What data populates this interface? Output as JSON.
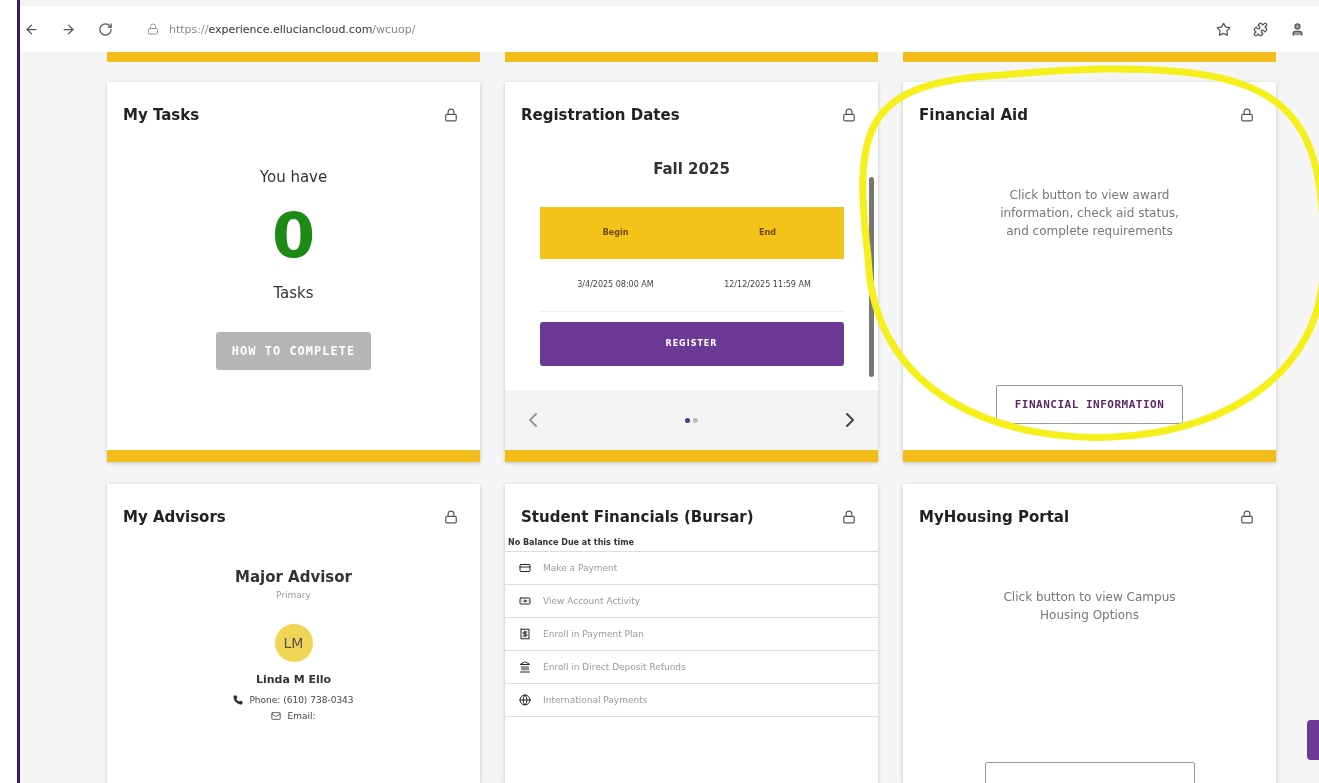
{
  "browser": {
    "url_scheme": "https://",
    "url_host": "experience.elluciancloud.com",
    "url_path": "/wcuop/"
  },
  "cards": [
    {
      "kind": "tasks",
      "title": "My Tasks",
      "intro": "You have",
      "count": "0",
      "unit": "Tasks",
      "button": {
        "label": "HOW TO COMPLETE",
        "disabled": true
      }
    },
    {
      "kind": "registration",
      "title": "Registration Dates",
      "term": "Fall 2025",
      "columns": [
        "Begin",
        "End"
      ],
      "row": [
        "3/4/2025 08:00 AM",
        "12/12/2025 11:59 AM"
      ],
      "button": "REGISTER",
      "pages": [
        {
          "selected": true
        },
        {
          "selected": false
        }
      ]
    },
    {
      "kind": "info",
      "title": "Financial Aid",
      "text": "Click button to view award information, check aid status, and complete requirements",
      "button": "FINANCIAL INFORMATION",
      "highlighted": true
    },
    {
      "kind": "advisors",
      "title": "My Advisors",
      "role": "Major Advisor",
      "rank": "Primary",
      "initials": "LM",
      "name": "Linda M Ello",
      "phone": "Phone: (610) 738-0343",
      "email": "Email:"
    },
    {
      "kind": "bursar",
      "title": "Student Financials (Bursar)",
      "balance": "No Balance Due at this time",
      "links": [
        "Make a Payment",
        "View Account Activity",
        "Enroll in Payment Plan",
        "Enroll in Direct Deposit Refunds",
        "International Payments"
      ]
    },
    {
      "kind": "info",
      "title": "MyHousing Portal",
      "text": "Click button to view Campus Housing Options",
      "highlighted": false
    }
  ]
}
